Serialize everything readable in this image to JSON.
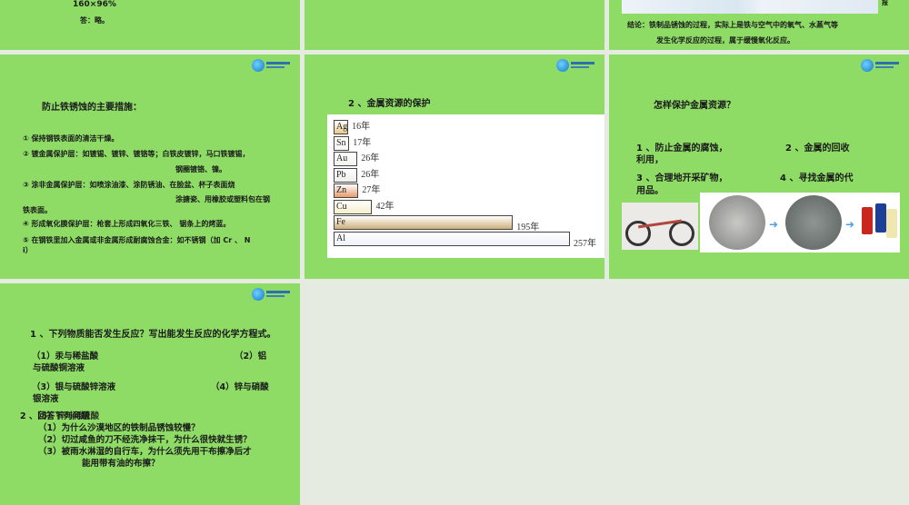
{
  "slides": [
    {
      "lines": {
        "formula": "160×96%",
        "answer": "答：略。"
      }
    },
    {},
    {
      "partial_char": "报",
      "conclusion_1": "结论：铁制品锈蚀的过程，实际上是铁与空气中的氧气、水蒸气等",
      "conclusion_2": "发生化学反应的过程，属于缓慢氧化反应。"
    },
    {
      "title": "防止铁锈蚀的主要措施：",
      "items": [
        "① 保持钢铁表面的清洁干燥。",
        "② 镀金属保护层：如镀锡、镀锌、镀铬等；白铁皮镀锌，马口铁镀锡，",
        "钢圈镀铬、镍。",
        "③ 涂非金属保护层：如喷涂油漆、涂防锈油、在脸盆、杯子表面烧",
        "涂搪瓷、用橡胶或塑料包在钢",
        "铁表面。",
        "④ 形成氧化膜保护层：枪套上形成四氧化三铁、 锯条上的烤蓝。",
        "⑤ 在钢铁里加入金属或非金属形成耐腐蚀合金：如不锈钢（加 Cr 、 N",
        "i）"
      ]
    },
    {
      "title": "2 、金属资源的保护"
    },
    {
      "title": "怎样保护金属资源？",
      "items": [
        "1 、防止金属的腐蚀，",
        "2 、金属的回收",
        "利用，",
        "3 、合理地开采矿物，",
        "4 、寻找金属的代",
        "用品。"
      ]
    },
    {
      "title": "1 、下列物质能否发生反应？写出能发生反应的化学方程式。",
      "items": [
        "（1）汞与稀盐酸",
        "（2）铝",
        "与硫酸铜溶液",
        "（3）银与硫酸锌溶液",
        "（4）锌与硝酸",
        "银溶液"
      ],
      "q2": "2 、回答下列问题",
      "q2_overlap": "（5）锌与稀硫酸",
      "questions": [
        "（1）为什么沙漠地区的铁制品锈蚀较慢？",
        "（2）切过咸鱼的刀不经洗净抹干，为什么很快就生锈？",
        "（3）被雨水淋湿的自行车，为什么须先用干布擦净后才",
        "能用带有油的布擦？"
      ]
    }
  ],
  "chart_data": {
    "type": "bar",
    "title": "2 、金属资源的保护",
    "categories": [
      "Ag",
      "Sn",
      "Au",
      "Pb",
      "Zn",
      "Cu",
      "Fe",
      "Al"
    ],
    "values": [
      16,
      17,
      26,
      26,
      27,
      42,
      195,
      257
    ],
    "labels": [
      "16年",
      "17年",
      "26年",
      "26年",
      "27年",
      "42年",
      "195年",
      "257年"
    ],
    "colors": [
      "#e8c98a",
      "#f6f6f2",
      "#f2f2ee",
      "#eeeeea",
      "#e79a6c",
      "#f6efcc",
      "#cdb07a",
      "#eef2f8"
    ]
  }
}
